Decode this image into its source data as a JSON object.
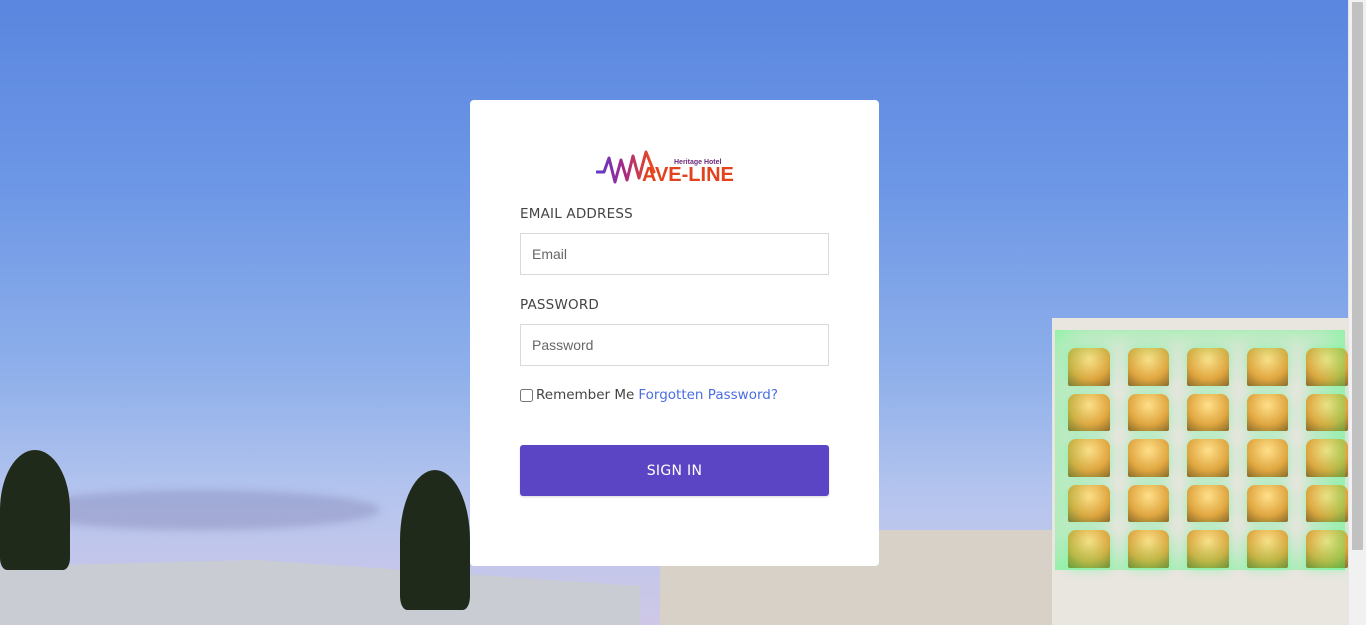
{
  "logo": {
    "brand": "AVE-LINE",
    "tagline": "Heritage Hotel"
  },
  "form": {
    "email_label": "EMAIL ADDRESS",
    "email_placeholder": "Email",
    "email_value": "",
    "password_label": "PASSWORD",
    "password_placeholder": "Password",
    "password_value": "",
    "remember_label": "Remember Me",
    "remember_checked": false,
    "forgot_link": "Forgotten Password?",
    "submit_label": "SIGN IN"
  },
  "colors": {
    "primary_button": "#5b45c4",
    "link": "#4a6ee0",
    "logo_accent": "#e2431e"
  },
  "icons": {
    "logo_wave": "wave-logo-icon"
  }
}
